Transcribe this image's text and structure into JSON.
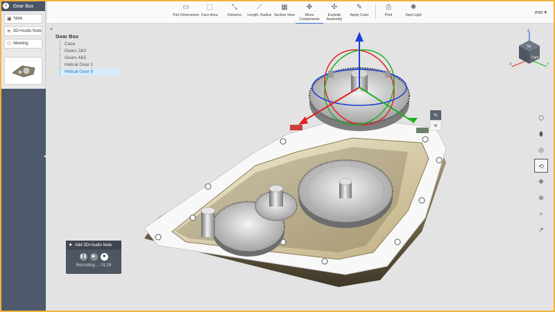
{
  "window": {
    "title": "Gear Box",
    "units": "mm"
  },
  "sidebar": {
    "buttons": [
      {
        "label": "Note",
        "icon": "note-icon"
      },
      {
        "label": "3D+Audio Note",
        "icon": "audio-wave-icon"
      },
      {
        "label": "Meeting",
        "icon": "users-icon"
      }
    ]
  },
  "toolbar": {
    "tools": [
      {
        "label": "Part Dimensions",
        "icon": "dimensions-icon"
      },
      {
        "label": "Face Area",
        "icon": "face-area-icon"
      },
      {
        "label": "Distance",
        "icon": "distance-icon"
      },
      {
        "label": "Length, Radius",
        "icon": "length-radius-icon"
      },
      {
        "label": "Section View",
        "icon": "section-view-icon"
      },
      {
        "label": "Move Components",
        "icon": "move-components-icon"
      },
      {
        "label": "Explode Assembly",
        "icon": "explode-icon"
      },
      {
        "label": "Apply Color",
        "icon": "paint-icon"
      },
      {
        "label": "Print",
        "icon": "print-icon"
      },
      {
        "label": "Spot Light",
        "icon": "spotlight-icon"
      }
    ]
  },
  "tree": {
    "root": "Gear Box",
    "items": [
      "Case",
      "Gears 2&3",
      "Gears 4&5",
      "Helical Gear 1",
      "Helical Gear 6"
    ],
    "selected_index": 4
  },
  "recording": {
    "title": "Add 3D+Audio Note",
    "status": "Recording ... 01:28"
  },
  "viewcube": {
    "faces": [
      "Top",
      "Right"
    ],
    "axes": [
      "X",
      "Y",
      "Z"
    ]
  },
  "colors": {
    "accent_border": "#f2b33d",
    "panel_dark": "#4e5a6b",
    "selection": "#d7ecfb",
    "gizmo_red": "#e02020",
    "gizmo_green": "#20b020",
    "gizmo_blue": "#1a3fd6"
  }
}
